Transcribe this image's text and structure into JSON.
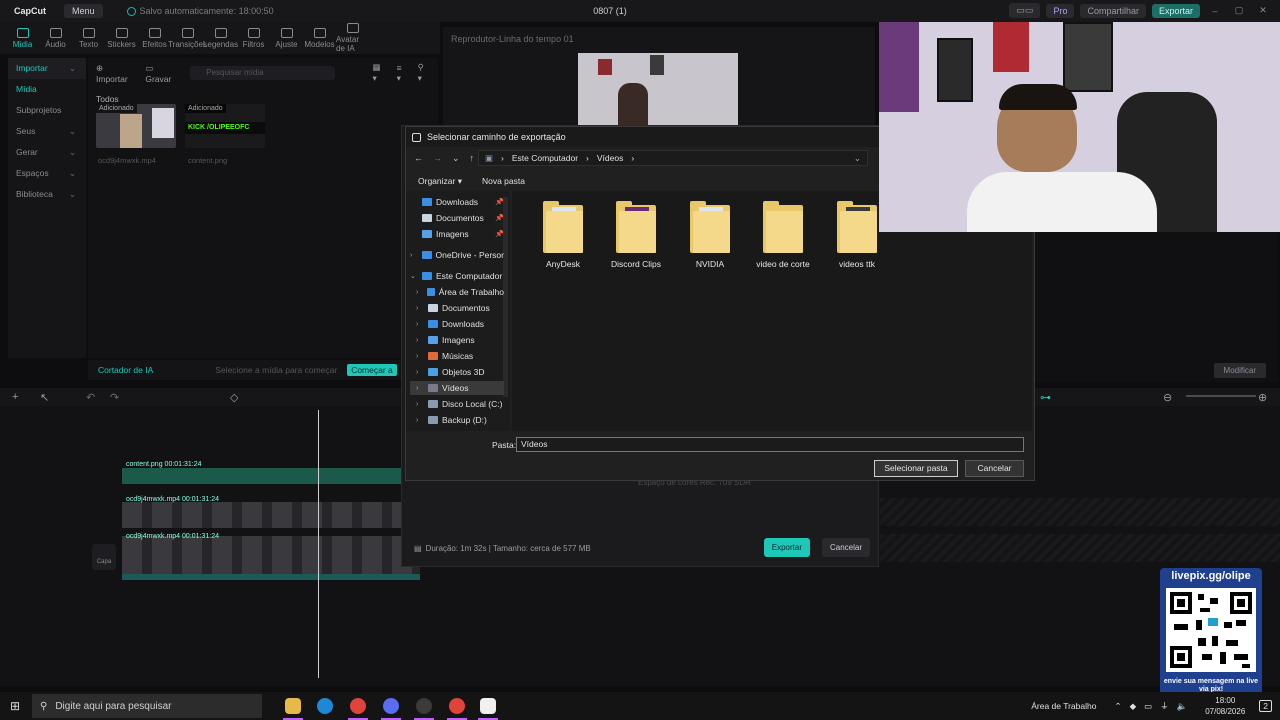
{
  "app": {
    "logo": "CapCut",
    "menu": "Menu",
    "autosave": "Salvo automaticamente: 18:00:50",
    "project_title": "0807 (1)",
    "pro": "Pro",
    "share": "Compartilhar",
    "export": "Exportar"
  },
  "toolbar": [
    {
      "label": "Mídia",
      "active": true
    },
    {
      "label": "Áudio"
    },
    {
      "label": "Texto"
    },
    {
      "label": "Stickers"
    },
    {
      "label": "Efeitos"
    },
    {
      "label": "Transições"
    },
    {
      "label": "Legendas"
    },
    {
      "label": "Filtros"
    },
    {
      "label": "Ajuste"
    },
    {
      "label": "Modelos"
    },
    {
      "label": "Avatar de IA"
    }
  ],
  "sidebar": [
    {
      "label": "Importar",
      "head": true
    },
    {
      "label": "Mídia",
      "selected": true
    },
    {
      "label": "Subprojetos"
    },
    {
      "label": "Seus"
    },
    {
      "label": "Gerar"
    },
    {
      "label": "Espaços"
    },
    {
      "label": "Biblioteca"
    }
  ],
  "media": {
    "import": "Importar",
    "record": "Gravar",
    "search_placeholder": "Pesquisar mídia",
    "section": "Todos",
    "items": [
      {
        "badge": "Adicionado",
        "name": "ocd9j4mwxk.mp4"
      },
      {
        "badge": "Adicionado",
        "name": "content.png",
        "overlay": "KICK /OLIPEEOFC"
      }
    ],
    "ai_cutter": "Cortador de IA",
    "ai_hint": "Selecione a mídia para começar",
    "ai_start": "Começar a"
  },
  "player": {
    "title": "Reprodutor-Linha do tempo 01"
  },
  "right_panel": {
    "modify": "Modificar"
  },
  "timeline": {
    "tracks": [
      {
        "name": "content.png",
        "time": "00:01:31:24"
      },
      {
        "name": "ocd9j4mwxk.mp4",
        "time": "00:01:31:24"
      },
      {
        "name": "ocd9j4mwxk.mp4",
        "time": "00:01:31:24"
      }
    ],
    "cover": "Capa"
  },
  "export_dialog": {
    "info": "Duração: 1m 32s | Tamanho: cerca de 577 MB",
    "export": "Exportar",
    "cancel": "Cancelar",
    "faded_text": "Espaço de cores     Rec. 709 SDR"
  },
  "picker": {
    "title": "Selecionar caminho de exportação",
    "breadcrumb": [
      "Este Computador",
      "Vídeos"
    ],
    "organize": "Organizar",
    "new_folder": "Nova pasta",
    "nav": [
      {
        "label": "Downloads",
        "pinned": true,
        "color": "#3a8ee6"
      },
      {
        "label": "Documentos",
        "pinned": true,
        "color": "#c8d4e0"
      },
      {
        "label": "Imagens",
        "pinned": true,
        "color": "#5aa0e8"
      },
      {
        "label": "OneDrive - Persor",
        "color": "#3a8ee6",
        "expand": true
      },
      {
        "label": "Este Computador",
        "color": "#3a8ee6",
        "open": true
      },
      {
        "label": "Área de Trabalho",
        "color": "#3a8ee6",
        "expand": true,
        "indent": true
      },
      {
        "label": "Documentos",
        "color": "#c8d4e0",
        "expand": true,
        "indent": true
      },
      {
        "label": "Downloads",
        "color": "#3a8ee6",
        "expand": true,
        "indent": true
      },
      {
        "label": "Imagens",
        "color": "#5aa0e8",
        "expand": true,
        "indent": true
      },
      {
        "label": "Músicas",
        "color": "#e06a3a",
        "expand": true,
        "indent": true
      },
      {
        "label": "Objetos 3D",
        "color": "#4aa0e0",
        "expand": true,
        "indent": true
      },
      {
        "label": "Vídeos",
        "color": "#7a7a8a",
        "expand": true,
        "indent": true,
        "selected": true
      },
      {
        "label": "Disco Local (C:)",
        "color": "#8a9ab0",
        "expand": true,
        "indent": true
      },
      {
        "label": "Backup (D:)",
        "color": "#8a9ab0",
        "expand": true,
        "indent": true
      }
    ],
    "folders": [
      {
        "label": "AnyDesk",
        "paper": "#dfe6ef"
      },
      {
        "label": "Discord Clips",
        "paper": "#6a2a7a"
      },
      {
        "label": "NVIDIA",
        "paper": "#dfe6ef"
      },
      {
        "label": "video de corte",
        "paper": "none"
      },
      {
        "label": "videos ttk",
        "paper": "#3a3a3a"
      }
    ],
    "folder_label": "Pasta:",
    "folder_value": "Vídeos",
    "select": "Selecionar pasta",
    "cancel": "Cancelar"
  },
  "overlay": {
    "title": "livepix.gg/olipe",
    "message": "envie sua mensagem na live via pix!"
  },
  "taskbar": {
    "search": "Digite aqui para pesquisar",
    "desktop": "Área de Trabalho",
    "time": "18:00",
    "date": "07/08/2026",
    "notif": "2"
  }
}
